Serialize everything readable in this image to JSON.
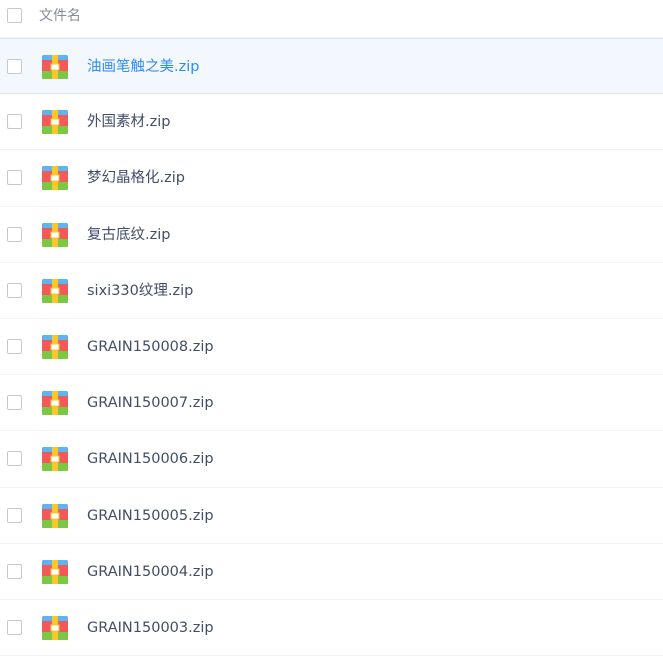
{
  "header": {
    "column_label": "文件名"
  },
  "files": [
    {
      "name": "油画笔触之美.zip",
      "selected": true
    },
    {
      "name": "外国素材.zip",
      "selected": false
    },
    {
      "name": "梦幻晶格化.zip",
      "selected": false
    },
    {
      "name": "复古底纹.zip",
      "selected": false
    },
    {
      "name": "sixi330纹理.zip",
      "selected": false
    },
    {
      "name": "GRAIN150008.zip",
      "selected": false
    },
    {
      "name": "GRAIN150007.zip",
      "selected": false
    },
    {
      "name": "GRAIN150006.zip",
      "selected": false
    },
    {
      "name": "GRAIN150005.zip",
      "selected": false
    },
    {
      "name": "GRAIN150004.zip",
      "selected": false
    },
    {
      "name": "GRAIN150003.zip",
      "selected": false
    }
  ],
  "colors": {
    "selected_text": "#2d8cf0",
    "row_text": "#424e67",
    "header_text": "#878c9c",
    "zip_red": "#f25a5a",
    "zip_yellow": "#f8c72c",
    "zip_green": "#7bc843",
    "zip_blue": "#5cb4f0"
  },
  "icons": {
    "file_icon": "zip-archive-icon"
  }
}
